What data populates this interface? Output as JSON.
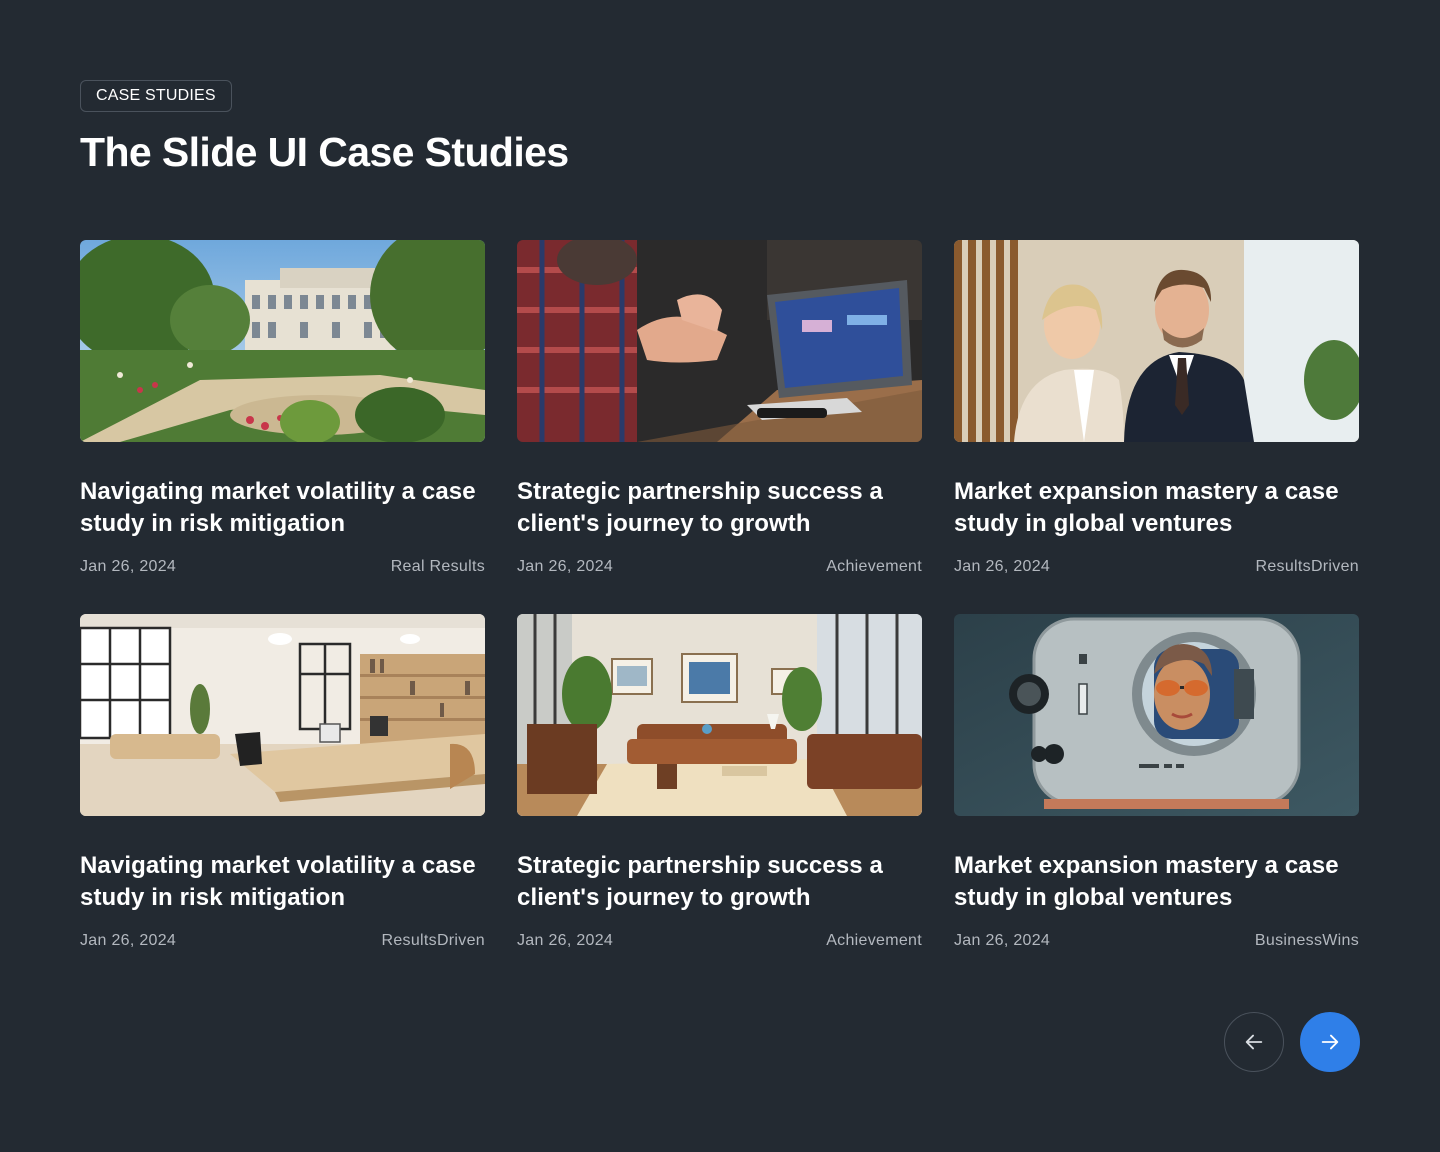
{
  "header": {
    "badge": "CASE STUDIES",
    "title": "The Slide UI Case Studies"
  },
  "cards": [
    {
      "title": "Navigating market volatility a case study in risk mitigation",
      "date": "Jan 26, 2024",
      "tag": "Real Results",
      "image": "palace-garden-image"
    },
    {
      "title": "Strategic partnership success a client's journey to growth",
      "date": "Jan 26, 2024",
      "tag": "Achievement",
      "image": "meeting-laptop-image"
    },
    {
      "title": "Market expansion mastery a case study in global ventures",
      "date": "Jan 26, 2024",
      "tag": "ResultsDriven",
      "image": "business-people-image"
    },
    {
      "title": "Navigating market volatility a case study in risk mitigation",
      "date": "Jan 26, 2024",
      "tag": "ResultsDriven",
      "image": "bright-office-image"
    },
    {
      "title": "Strategic partnership success a client's journey to growth",
      "date": "Jan 26, 2024",
      "tag": "Achievement",
      "image": "lounge-room-image"
    },
    {
      "title": "Market expansion mastery a case study in global ventures",
      "date": "Jan 26, 2024",
      "tag": "BusinessWins",
      "image": "retro-robot-image"
    }
  ],
  "colors": {
    "background": "#232a32",
    "accent": "#2f7fe8",
    "muted_text": "#b3b8bf"
  },
  "navigation": {
    "prev_icon": "arrow-left-icon",
    "next_icon": "arrow-right-icon"
  }
}
